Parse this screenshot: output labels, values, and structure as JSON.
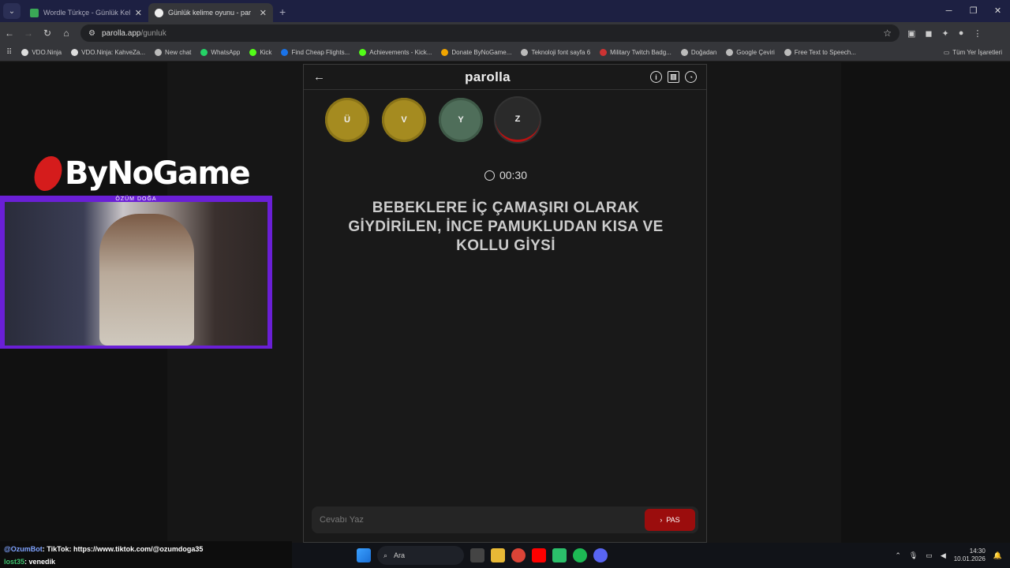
{
  "browser": {
    "tabs": [
      {
        "title": "Wordle Türkçe - Günlük Kelime",
        "active": false,
        "icon_color": "#3aa856"
      },
      {
        "title": "Günlük kelime oyunu - par",
        "active": true,
        "icon_color": "#eeeeee"
      }
    ],
    "url_host": "parolla.app",
    "url_path": "/gunluk",
    "bookmarks": [
      {
        "label": "VDO.Ninja",
        "icon_color": "#dddddd"
      },
      {
        "label": "VDO.Ninja: KahveZa...",
        "icon_color": "#dddddd"
      },
      {
        "label": "New chat",
        "icon_color": "#bbbbbb"
      },
      {
        "label": "WhatsApp",
        "icon_color": "#25d366"
      },
      {
        "label": "Kick",
        "icon_color": "#53fc18"
      },
      {
        "label": "Find Cheap Flights...",
        "icon_color": "#1a73e8"
      },
      {
        "label": "Achievements - Kick...",
        "icon_color": "#53fc18"
      },
      {
        "label": "Donate ByNoGame...",
        "icon_color": "#f0a500"
      },
      {
        "label": "Teknoloji font sayfa 6",
        "icon_color": "#bbbbbb"
      },
      {
        "label": "Military Twitch Badg...",
        "icon_color": "#cc3333"
      },
      {
        "label": "Doğadan",
        "icon_color": "#bbbbbb"
      },
      {
        "label": "Google Çeviri",
        "icon_color": "#bbbbbb"
      },
      {
        "label": "Free Text to Speech...",
        "icon_color": "#bbbbbb"
      }
    ],
    "all_bookmarks": "Tüm Yer İşaretleri"
  },
  "app": {
    "title": "parolla",
    "letters": [
      {
        "char": "Ü",
        "state": "yellow"
      },
      {
        "char": "V",
        "state": "yellow"
      },
      {
        "char": "Y",
        "state": "green"
      },
      {
        "char": "Z",
        "state": "current"
      }
    ],
    "timer": "00:30",
    "question": "BEBEKLERE İÇ ÇAMAŞIRI OLARAK GİYDİRİLEN, İNCE PAMUKLUDAN KISA VE KOLLU GİYSİ",
    "answer_placeholder": "Cevabı Yaz",
    "pass_label": "PAS"
  },
  "overlay": {
    "brand": "ByNoGame",
    "streamer": "ÖZÜM DOĞA",
    "chat": [
      {
        "user": "@OzumBot",
        "message": ": TikTok: https://www.tiktok.com/@ozumdoga35"
      },
      {
        "user": "lost35",
        "message": ": venedik"
      }
    ]
  },
  "taskbar": {
    "search_label": "Ara",
    "time": "14:30",
    "date": "10.01.2026"
  }
}
